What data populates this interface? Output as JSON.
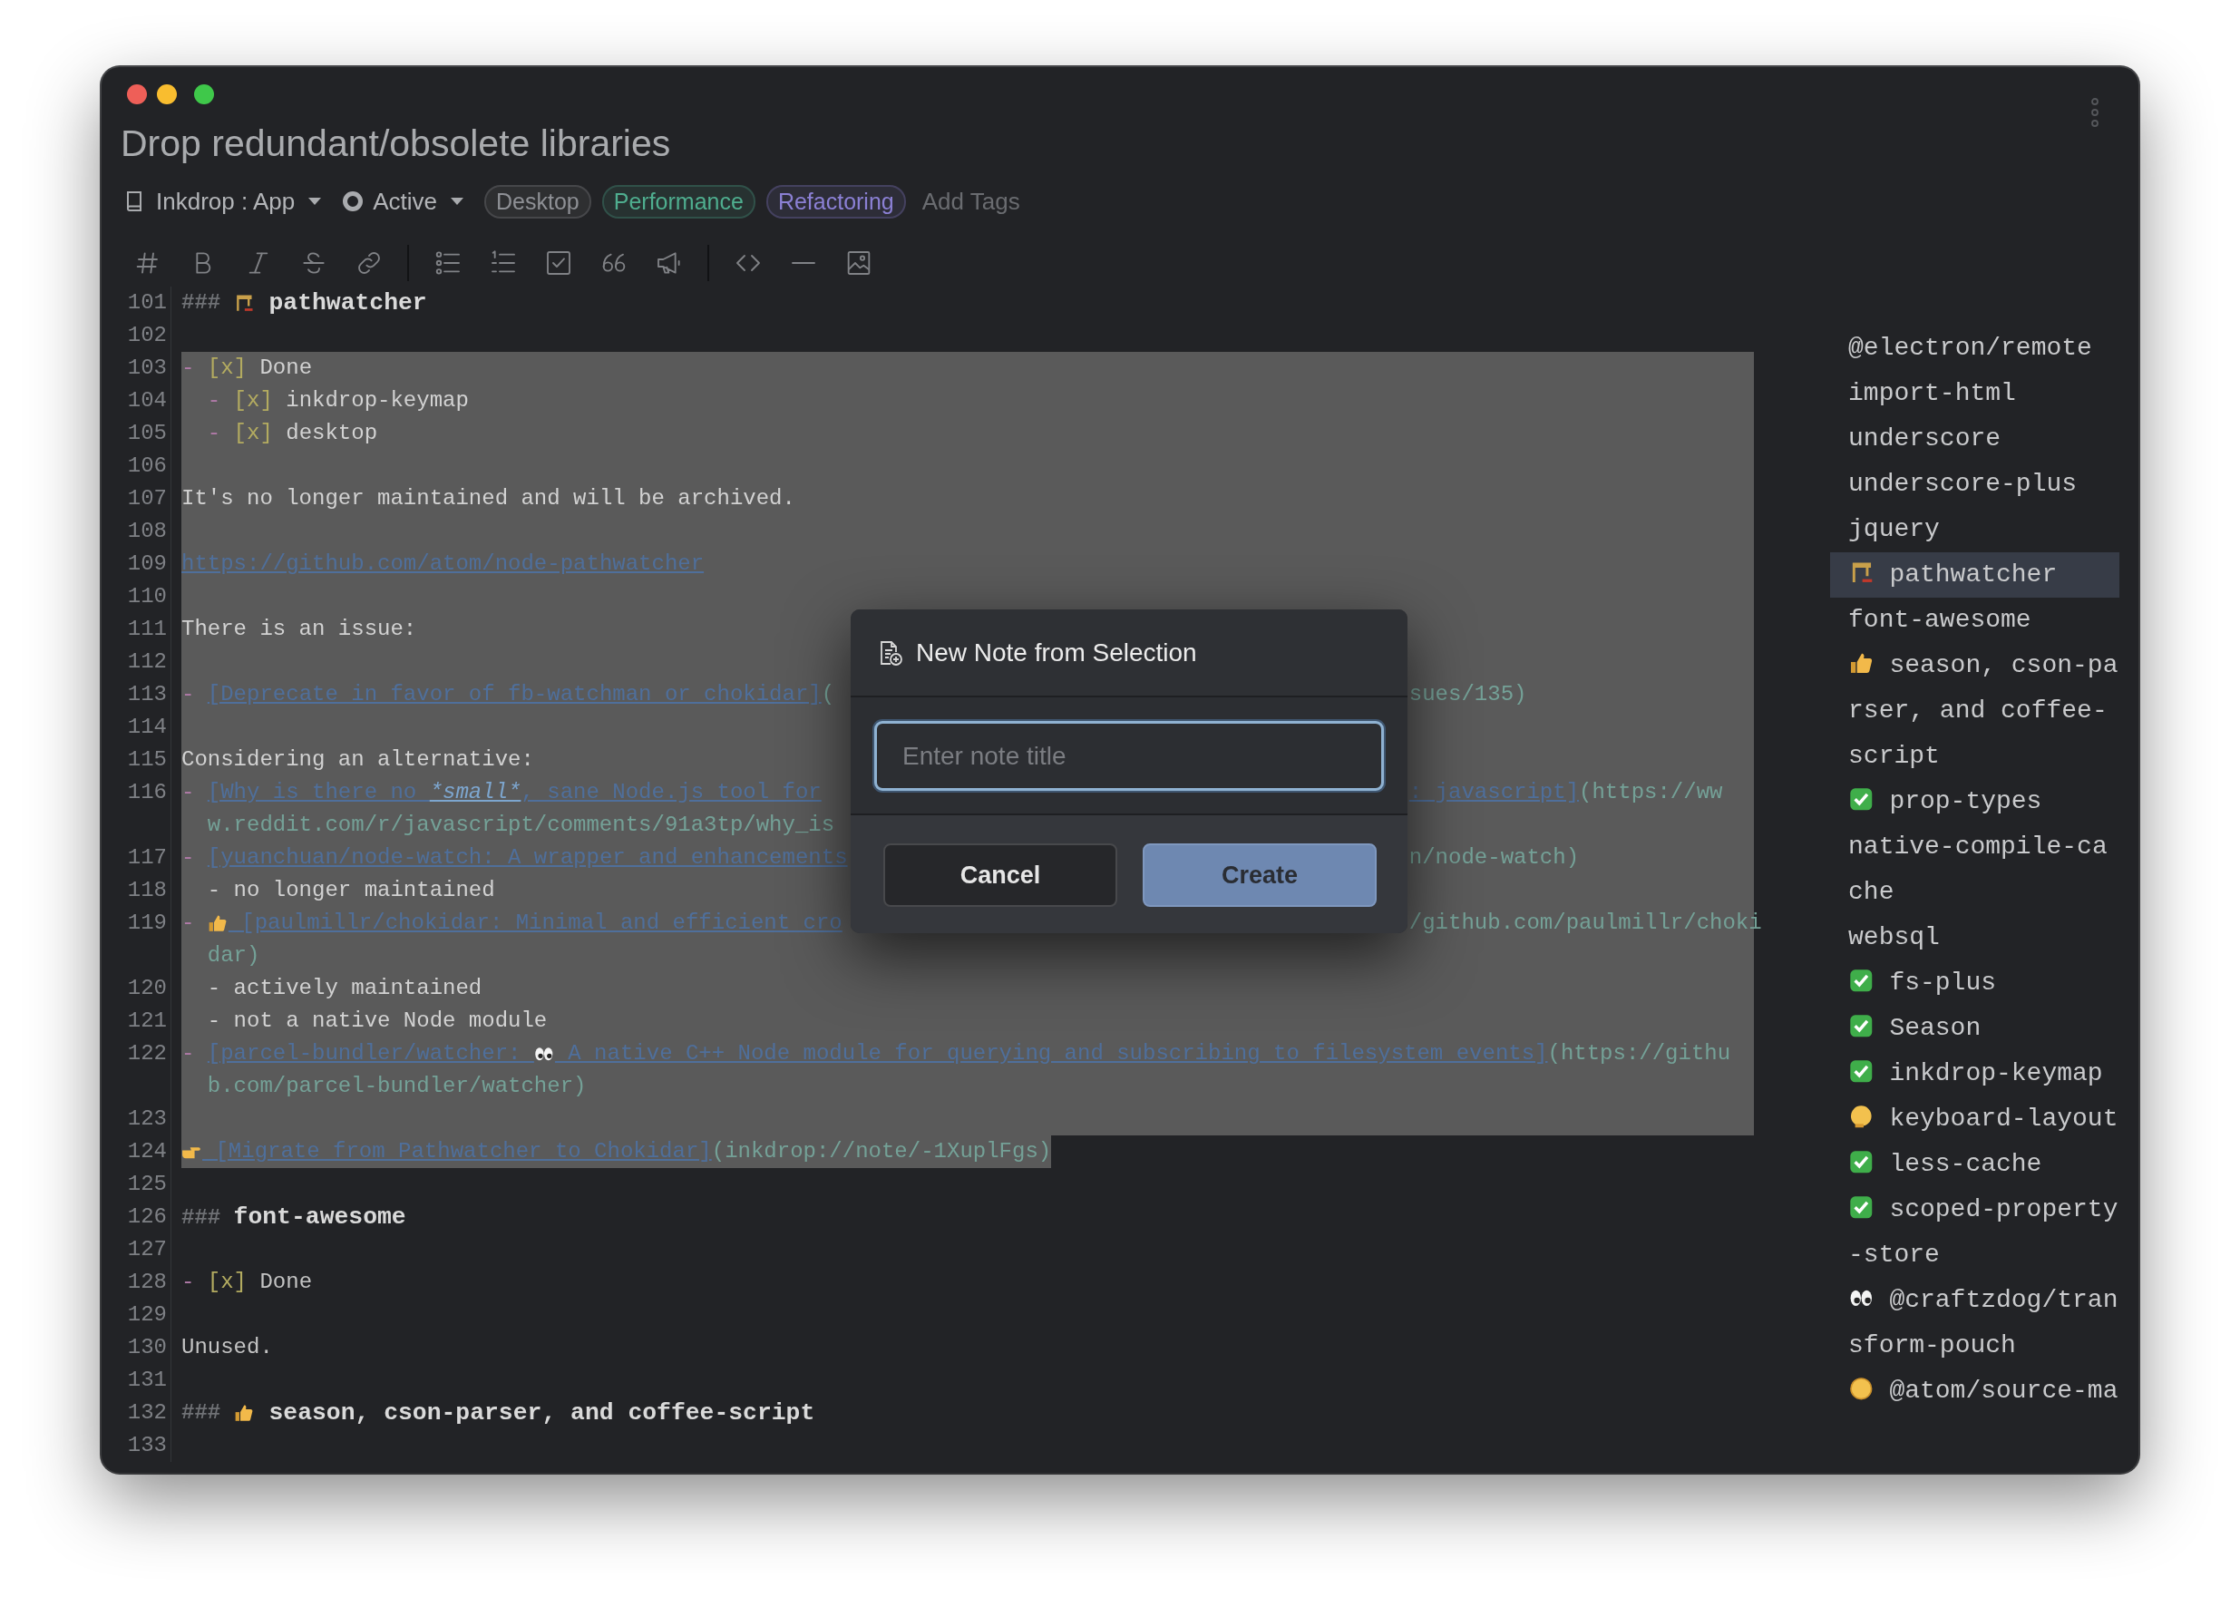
{
  "header": {
    "title": "Drop redundant/obsolete libraries",
    "notebook": "Inkdrop : App",
    "status": "Active",
    "tags": [
      {
        "label": "Desktop",
        "color": "#8e9095"
      },
      {
        "label": "Performance",
        "color": "#4fae8f"
      },
      {
        "label": "Refactoring",
        "color": "#8b80d4"
      }
    ],
    "add_tags": {
      "placeholder": "Add Tags"
    }
  },
  "editor": {
    "lines": [
      {
        "number": "101",
        "kind": "line",
        "selected": false,
        "segments": [
          {
            "kind": "hash",
            "text": "### "
          },
          {
            "kind": "crane"
          },
          {
            "kind": "heading",
            "text": " pathwatcher"
          }
        ]
      },
      {
        "number": "102",
        "kind": "line",
        "selected": false
      },
      {
        "number": "103",
        "kind": "line",
        "selected": true,
        "segments": [
          {
            "kind": "mark",
            "text": "- "
          },
          {
            "kind": "check",
            "text": "[x]"
          },
          {
            "kind": "text",
            "text": " Done"
          }
        ]
      },
      {
        "number": "104",
        "kind": "nested",
        "selected": true,
        "segments": [
          {
            "kind": "mark",
            "text": "- "
          },
          {
            "kind": "check",
            "text": "[x]"
          },
          {
            "kind": "text",
            "text": " inkdrop-keymap"
          }
        ]
      },
      {
        "number": "105",
        "kind": "nested",
        "selected": true,
        "segments": [
          {
            "kind": "mark",
            "text": "- "
          },
          {
            "kind": "check",
            "text": "[x]"
          },
          {
            "kind": "text",
            "text": " desktop"
          }
        ]
      },
      {
        "number": "106",
        "kind": "line",
        "selected": true
      },
      {
        "number": "107",
        "kind": "line",
        "selected": true,
        "segments": [
          {
            "kind": "text",
            "text": "It's no longer maintained and will be archived."
          }
        ]
      },
      {
        "number": "108",
        "kind": "line",
        "selected": true
      },
      {
        "number": "109",
        "kind": "line",
        "selected": true,
        "segments": [
          {
            "kind": "link",
            "text": "https://github.com/atom/node-pathwatcher"
          }
        ]
      },
      {
        "number": "110",
        "kind": "line",
        "selected": true
      },
      {
        "number": "111",
        "kind": "line",
        "selected": true,
        "segments": [
          {
            "kind": "text",
            "text": "There is an issue:"
          }
        ]
      },
      {
        "number": "112",
        "kind": "line",
        "selected": true
      },
      {
        "number": "113",
        "kind": "line",
        "selected": true,
        "segments": [
          {
            "kind": "mark",
            "text": "- "
          },
          {
            "kind": "link",
            "text": "[Deprecate in favor of fb-watchman or chokidar]"
          },
          {
            "kind": "url",
            "text": "("
          }
        ],
        "tail": [
          {
            "kind": "url",
            "text": "sues/135)"
          }
        ]
      },
      {
        "number": "114",
        "kind": "line",
        "selected": true
      },
      {
        "number": "115",
        "kind": "line",
        "selected": true,
        "segments": [
          {
            "kind": "text",
            "text": "Considering an alternative:"
          }
        ]
      },
      {
        "number": "116",
        "kind": "line",
        "selected": true,
        "segments": [
          {
            "kind": "mark",
            "text": "- "
          },
          {
            "kind": "link",
            "text": "[Why is there no "
          },
          {
            "kind": "em",
            "text": "*small*"
          },
          {
            "kind": "link",
            "text": ", sane Node.js tool for"
          }
        ],
        "tail": [
          {
            "kind": "link",
            "text": ": javascript]"
          },
          {
            "kind": "url",
            "text": "(https://ww"
          }
        ]
      },
      {
        "kind": "wrap",
        "selected": true,
        "segments": [
          {
            "kind": "url",
            "text": "w.reddit.com/r/javascript/comments/91a3tp/why_is"
          }
        ]
      },
      {
        "number": "117",
        "kind": "line",
        "selected": true,
        "segments": [
          {
            "kind": "mark",
            "text": "- "
          },
          {
            "kind": "link",
            "text": "[yuanchuan/node-watch: A wrapper and enhancements"
          }
        ],
        "tail": [
          {
            "kind": "url",
            "text": "n/node-watch)"
          }
        ]
      },
      {
        "number": "118",
        "kind": "nested",
        "selected": true,
        "segments": [
          {
            "kind": "text",
            "text": "- no longer maintained"
          }
        ]
      },
      {
        "number": "119",
        "kind": "line",
        "selected": true,
        "segments": [
          {
            "kind": "mark",
            "text": "- "
          },
          {
            "kind": "thumbs-up"
          },
          {
            "kind": "link",
            "text": " [paulmillr/chokidar: Minimal and efficient cro"
          }
        ],
        "tail": [
          {
            "kind": "url",
            "text": "/github.com/paulmillr/choki"
          }
        ]
      },
      {
        "kind": "wrap",
        "selected": true,
        "segments": [
          {
            "kind": "url",
            "text": "dar)"
          }
        ]
      },
      {
        "number": "120",
        "kind": "nested",
        "selected": true,
        "segments": [
          {
            "kind": "text",
            "text": "- actively maintained"
          }
        ]
      },
      {
        "number": "121",
        "kind": "nested",
        "selected": true,
        "segments": [
          {
            "kind": "text",
            "text": "- not a native Node module"
          }
        ]
      },
      {
        "number": "122",
        "kind": "line",
        "selected": true,
        "segments": [
          {
            "kind": "mark",
            "text": "- "
          },
          {
            "kind": "link",
            "text": "[parcel-bundler/watcher: "
          },
          {
            "kind": "eyes"
          },
          {
            "kind": "link",
            "text": " A native C++ Node module for querying and subscribing to filesystem events]"
          },
          {
            "kind": "url",
            "text": "(https://githu"
          }
        ]
      },
      {
        "kind": "wrap",
        "selected": true,
        "segments": [
          {
            "kind": "url",
            "text": "b.com/parcel-bundler/watcher)"
          }
        ]
      },
      {
        "number": "123",
        "kind": "line",
        "selected": true
      },
      {
        "number": "124",
        "kind": "line",
        "selected": true,
        "segments": [
          {
            "kind": "point-right"
          },
          {
            "kind": "link",
            "text": " [Migrate from Pathwatcher to Chokidar]"
          },
          {
            "kind": "url",
            "text": "(inkdrop://note/-1XuplFgs)"
          }
        ]
      },
      {
        "number": "125",
        "kind": "line",
        "selected": false
      },
      {
        "number": "126",
        "kind": "line",
        "selected": false,
        "segments": [
          {
            "kind": "hash",
            "text": "### "
          },
          {
            "kind": "heading",
            "text": "font-awesome"
          }
        ]
      },
      {
        "number": "127",
        "kind": "line",
        "selected": false
      },
      {
        "number": "128",
        "kind": "line",
        "selected": false,
        "segments": [
          {
            "kind": "mark",
            "text": "- "
          },
          {
            "kind": "check",
            "text": "[x]"
          },
          {
            "kind": "text",
            "text": " Done"
          }
        ]
      },
      {
        "number": "129",
        "kind": "line",
        "selected": false
      },
      {
        "number": "130",
        "kind": "line",
        "selected": false,
        "segments": [
          {
            "kind": "text",
            "text": "Unused."
          }
        ]
      },
      {
        "number": "131",
        "kind": "line",
        "selected": false
      },
      {
        "number": "132",
        "kind": "line",
        "selected": false,
        "segments": [
          {
            "kind": "hash",
            "text": "### "
          },
          {
            "kind": "thumbs-up"
          },
          {
            "kind": "heading",
            "text": " season, cson-parser, and coffee-script"
          }
        ]
      },
      {
        "number": "133",
        "kind": "line",
        "selected": false
      }
    ]
  },
  "sidebar": {
    "items": [
      {
        "kind": "plain",
        "text": "@electron/remote",
        "selected": false
      },
      {
        "kind": "plain",
        "text": "import-html",
        "selected": false
      },
      {
        "kind": "plain",
        "text": "underscore",
        "selected": false
      },
      {
        "kind": "plain",
        "text": "underscore-plus",
        "selected": false
      },
      {
        "kind": "plain",
        "text": "jquery",
        "selected": false
      },
      {
        "kind": "crane",
        "text": "pathwatcher",
        "selected": true
      },
      {
        "kind": "plain",
        "text": "font-awesome",
        "selected": false
      },
      {
        "kind": "thumbs-up",
        "text": "season, cson-parser, and coffee-script",
        "selected": false
      },
      {
        "kind": "checkmark",
        "text": "prop-types",
        "selected": false
      },
      {
        "kind": "plain",
        "text": "native-compile-cache",
        "selected": false
      },
      {
        "kind": "plain",
        "text": "websql",
        "selected": false
      },
      {
        "kind": "checkmark",
        "text": "fs-plus",
        "selected": false
      },
      {
        "kind": "checkmark",
        "text": "Season",
        "selected": false
      },
      {
        "kind": "checkmark",
        "text": "inkdrop-keymap",
        "selected": false
      },
      {
        "kind": "thinking",
        "text": "keyboard-layout",
        "selected": false
      },
      {
        "kind": "checkmark",
        "text": "less-cache",
        "selected": false
      },
      {
        "kind": "checkmark",
        "text": "scoped-property-store",
        "selected": false
      },
      {
        "kind": "eyes",
        "text": "@craftzdog/transform-pouch",
        "selected": false
      },
      {
        "kind": "weary",
        "text": "@atom/source-ma",
        "selected": false
      }
    ]
  },
  "dialog": {
    "title": "New Note from Selection",
    "placeholder": "Enter note title",
    "buttons": [
      {
        "label": "Cancel",
        "kind": "secondary"
      },
      {
        "label": "Create",
        "kind": "primary"
      }
    ]
  }
}
